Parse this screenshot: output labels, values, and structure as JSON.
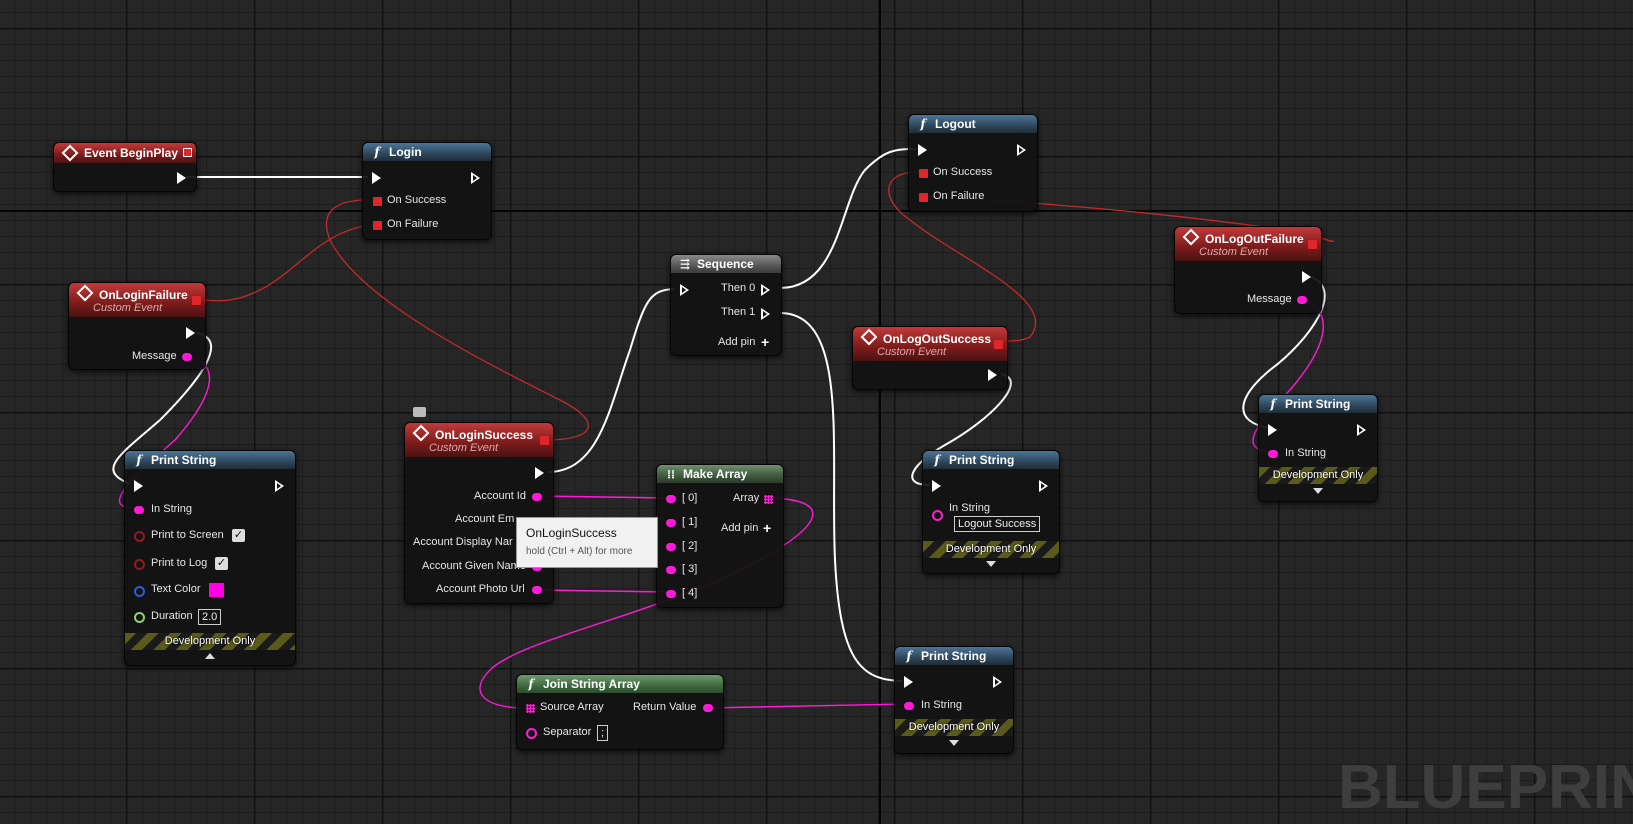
{
  "app": {
    "watermark": "BLUEPRINT"
  },
  "colors": {
    "exec": "#ffffff",
    "delegate": "#e0262a",
    "string": "#ff1ad8",
    "bool": "#8a1d20",
    "color": "#2a5cd8",
    "float": "#8bd468"
  },
  "nodes": {
    "event_begin_play": {
      "title": "Event BeginPlay"
    },
    "login": {
      "title": "Login",
      "on_success": "On Success",
      "on_failure": "On Failure"
    },
    "logout": {
      "title": "Logout",
      "on_success": "On Success",
      "on_failure": "On Failure"
    },
    "on_login_failure": {
      "title": "OnLoginFailure",
      "subtitle": "Custom Event",
      "message": "Message"
    },
    "print_string_1": {
      "title": "Print String",
      "in_string": "In String",
      "print_to_screen": "Print to Screen",
      "print_to_log": "Print to Log",
      "text_color": "Text Color",
      "duration": "Duration",
      "duration_value": "2.0",
      "dev_only": "Development Only"
    },
    "on_login_success": {
      "title": "OnLoginSuccess",
      "subtitle": "Custom Event",
      "pins": [
        "Account Id",
        "Account Em",
        "Account Display Nar",
        "Account Given Name",
        "Account Photo Url"
      ]
    },
    "sequence": {
      "title": "Sequence",
      "then0": "Then 0",
      "then1": "Then 1",
      "add_pin": "Add pin"
    },
    "make_array": {
      "title": "Make Array",
      "inputs": [
        "[ 0]",
        "[ 1]",
        "[ 2]",
        "[ 3]",
        "[ 4]"
      ],
      "output": "Array",
      "add_pin": "Add pin"
    },
    "join_string_array": {
      "title": "Join String Array",
      "source_array": "Source Array",
      "return_value": "Return Value",
      "separator": "Separator",
      "separator_value": ";"
    },
    "print_string_2": {
      "title": "Print String",
      "in_string": "In String",
      "dev_only": "Development Only"
    },
    "on_logout_success": {
      "title": "OnLogOutSuccess",
      "subtitle": "Custom Event"
    },
    "print_string_3": {
      "title": "Print String",
      "in_string": "In String",
      "in_string_value": "Logout Success",
      "dev_only": "Development Only"
    },
    "on_logout_failure": {
      "title": "OnLogOutFailure",
      "subtitle": "Custom Event",
      "message": "Message"
    },
    "print_string_4": {
      "title": "Print String",
      "in_string": "In String",
      "dev_only": "Development Only"
    }
  },
  "tooltip": {
    "title": "OnLoginSuccess",
    "hint": "hold (Ctrl + Alt) for more"
  }
}
